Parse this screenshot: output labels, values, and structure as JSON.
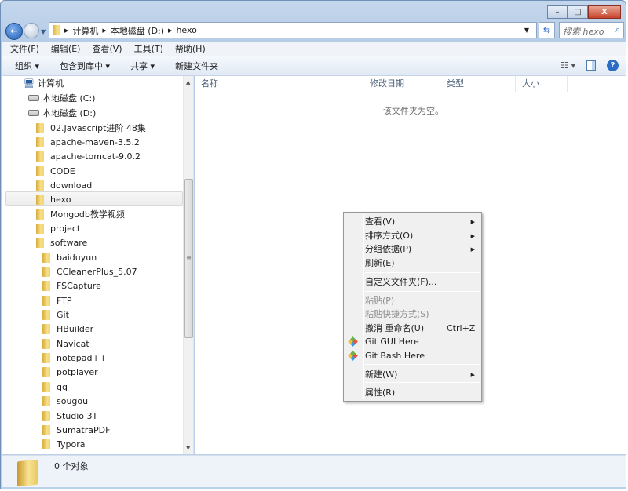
{
  "window": {
    "buttons": {
      "minimize": "–",
      "maximize": "□",
      "close": "X"
    }
  },
  "address": {
    "segments": [
      "计算机",
      "本地磁盘 (D:)",
      "hexo"
    ],
    "search_placeholder": "搜索 hexo"
  },
  "menubar": [
    "文件(F)",
    "编辑(E)",
    "查看(V)",
    "工具(T)",
    "帮助(H)"
  ],
  "toolbar": [
    "组织 ▾",
    "包含到库中 ▾",
    "共享 ▾",
    "新建文件夹"
  ],
  "tree": [
    {
      "label": "计算机",
      "icon": "computer-icon"
    },
    {
      "label": "本地磁盘 (C:)",
      "icon": "system-drive-icon"
    },
    {
      "label": "本地磁盘 (D:)",
      "icon": "drive-icon"
    },
    {
      "label": "02.Javascript进阶 48集"
    },
    {
      "label": "apache-maven-3.5.2"
    },
    {
      "label": "apache-tomcat-9.0.2"
    },
    {
      "label": "CODE"
    },
    {
      "label": "download"
    },
    {
      "label": "hexo",
      "selected": true
    },
    {
      "label": "Mongodb教学视频"
    },
    {
      "label": "project"
    },
    {
      "label": "software"
    },
    {
      "label": "baiduyun"
    },
    {
      "label": "CCleanerPlus_5.07"
    },
    {
      "label": "FSCapture"
    },
    {
      "label": "FTP"
    },
    {
      "label": "Git"
    },
    {
      "label": "HBuilder"
    },
    {
      "label": "Navicat"
    },
    {
      "label": "notepad++"
    },
    {
      "label": "potplayer"
    },
    {
      "label": "qq"
    },
    {
      "label": "sougou"
    },
    {
      "label": "Studio 3T"
    },
    {
      "label": "SumatraPDF"
    },
    {
      "label": "Typora"
    }
  ],
  "columns": [
    "名称",
    "修改日期",
    "类型",
    "大小"
  ],
  "empty_text": "该文件夹为空。",
  "status": "0 个对象",
  "context_menu": [
    {
      "label": "查看(V)",
      "submenu": true
    },
    {
      "label": "排序方式(O)",
      "submenu": true
    },
    {
      "label": "分组依据(P)",
      "submenu": true
    },
    {
      "label": "刷新(E)"
    },
    {
      "label": "自定义文件夹(F)..."
    },
    {
      "label": "粘贴(P)",
      "disabled": true
    },
    {
      "label": "粘贴快捷方式(S)",
      "disabled": true
    },
    {
      "label": "撤消 重命名(U)",
      "shortcut": "Ctrl+Z"
    },
    {
      "label": "Git GUI Here",
      "icon": "git-icon"
    },
    {
      "label": "Git Bash Here",
      "icon": "git-icon"
    },
    {
      "label": "新建(W)",
      "submenu": true
    },
    {
      "label": "属性(R)"
    }
  ]
}
